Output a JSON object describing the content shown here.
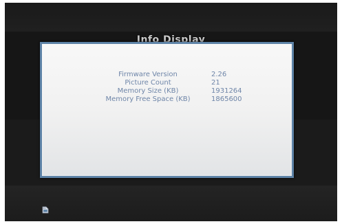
{
  "background": {
    "title": "Info Display"
  },
  "dialog": {
    "rows": [
      {
        "label": "Firmware Version",
        "value": "2.26"
      },
      {
        "label": "Picture Count",
        "value": "21"
      },
      {
        "label": "Memory Size (KB)",
        "value": "1931264"
      },
      {
        "label": "Memory Free Space (KB)",
        "value": "1865600"
      }
    ]
  },
  "footer": {
    "icon": "memory-card-icon"
  },
  "colors": {
    "screen": "#101010",
    "dialog_border": "#5f84a8",
    "dialog_text": "#6e85a8"
  }
}
